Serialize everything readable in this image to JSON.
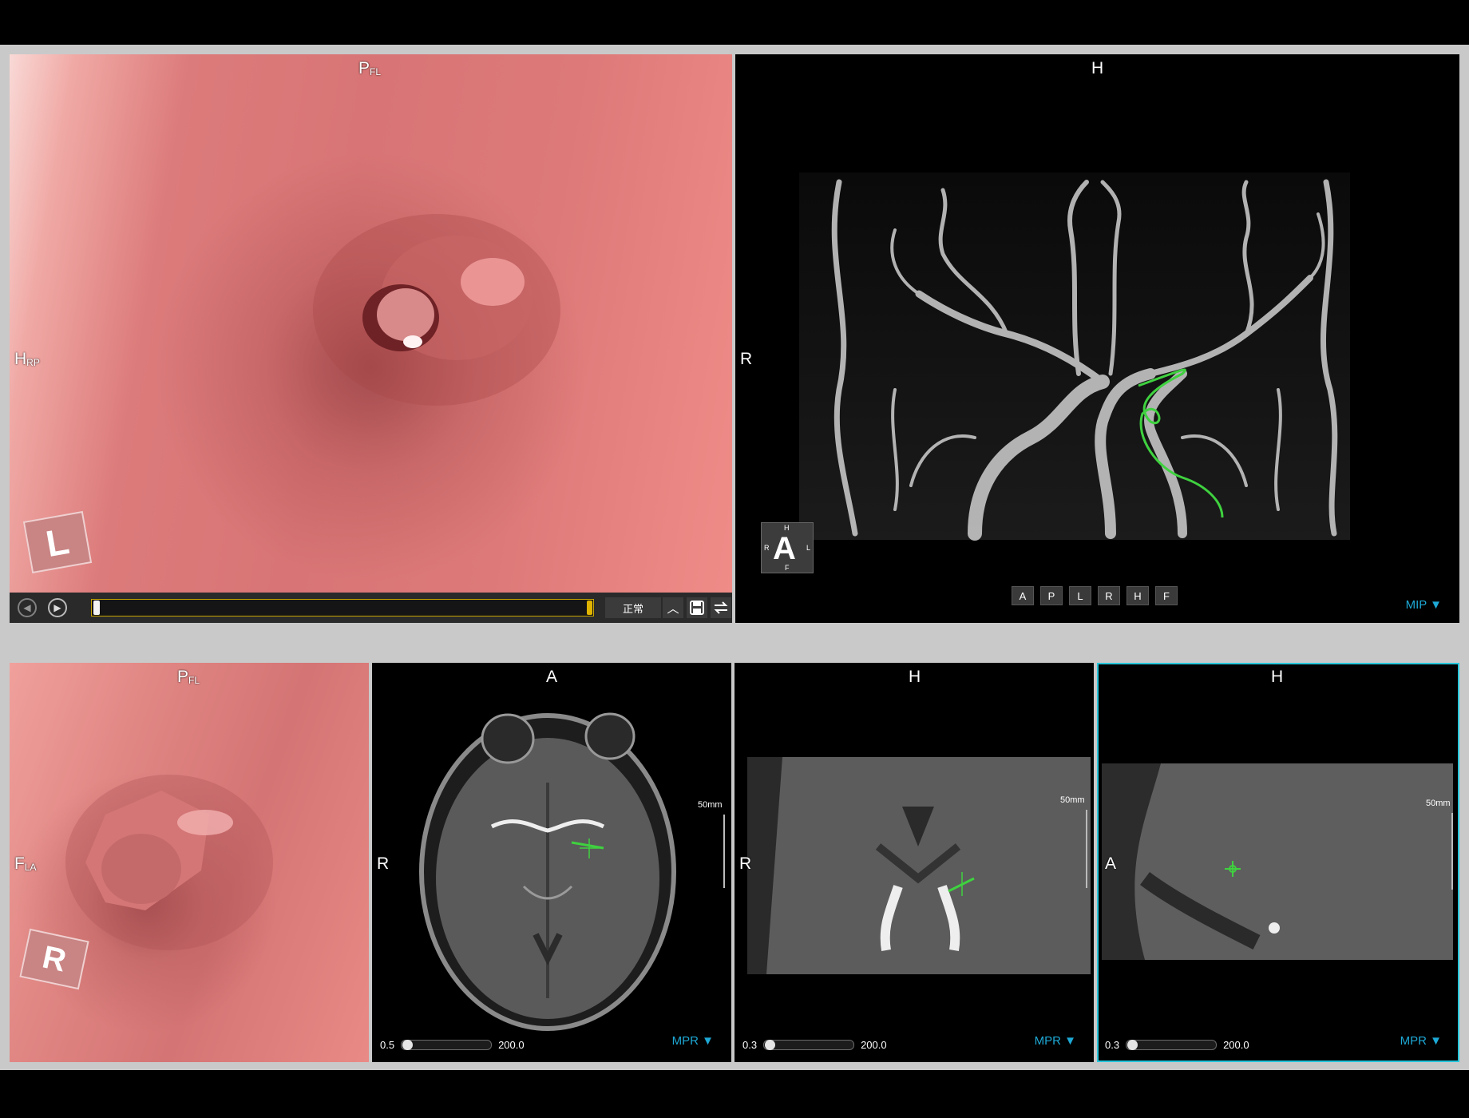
{
  "viewports": {
    "endo_main": {
      "top": "P",
      "top_sub": "FL",
      "left": "H",
      "left_sub": "RP",
      "cube_face": "L"
    },
    "mip": {
      "top": "H",
      "left": "R",
      "mode": "MIP ▼",
      "view_buttons": [
        "A",
        "P",
        "L",
        "R",
        "H",
        "F"
      ],
      "orient_cube": {
        "center": "A",
        "top": "H",
        "bottom": "F",
        "left": "R",
        "right": "L"
      }
    },
    "endo_small": {
      "top": "P",
      "top_sub": "FL",
      "left": "F",
      "left_sub": "LA",
      "cube_face": "R"
    },
    "mpr_axial": {
      "top": "A",
      "left": "R",
      "mode": "MPR ▼",
      "scale": "50mm",
      "slider_min": "0.5",
      "slider_max": "200.0"
    },
    "mpr_coronal": {
      "top": "H",
      "left": "R",
      "mode": "MPR ▼",
      "scale": "50mm",
      "slider_min": "0.3",
      "slider_max": "200.0"
    },
    "mpr_sagittal": {
      "top": "H",
      "left": "A",
      "mode": "MPR ▼",
      "scale": "50mm",
      "slider_min": "0.3",
      "slider_max": "200.0"
    }
  },
  "playback": {
    "speed_label": "正常",
    "up_icon": "chevron-up-icon",
    "save_icon": "save-icon",
    "swap_icon": "swap-icon"
  },
  "colors": {
    "accent": "#26c6da",
    "mode_text": "#1ea9d6",
    "vessel_path": "#3fd13f",
    "timeline_border": "#c7a300"
  }
}
